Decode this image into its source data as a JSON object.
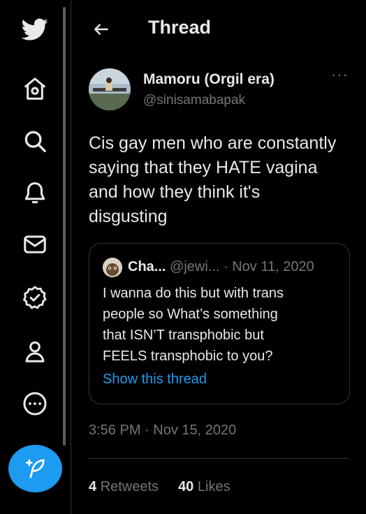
{
  "header": {
    "title": "Thread"
  },
  "sidebar": {
    "items": [
      {
        "icon": "twitter-bird-icon"
      },
      {
        "icon": "home-icon"
      },
      {
        "icon": "search-icon"
      },
      {
        "icon": "notifications-bell-icon"
      },
      {
        "icon": "messages-mail-icon"
      },
      {
        "icon": "verified-icon"
      },
      {
        "icon": "profile-icon"
      },
      {
        "icon": "more-icon"
      }
    ],
    "compose_icon": "compose-feather-icon"
  },
  "tweet": {
    "author_name": "Mamoru (Orgil era)",
    "author_handle": "@sinisamabapak",
    "text_lines": [
      "Cis gay men who are constantly",
      "saying that they HATE vagina",
      "and how they think it's",
      "disgusting"
    ],
    "timestamp": "3:56 PM · Nov 15, 2020",
    "retweets_count": "4",
    "retweets_label": "Retweets",
    "likes_count": "40",
    "likes_label": "Likes"
  },
  "quote": {
    "name": "Cha...",
    "handle_date": "@jewi... · Nov 11, 2020",
    "text_lines": [
      "I wanna do this but with trans",
      "people so What’s something",
      "that ISN’T transphobic but",
      "FEELS transphobic to you?"
    ],
    "show_thread": "Show this thread"
  },
  "colors": {
    "background": "#000000",
    "accent": "#1d9bf0",
    "text_primary": "#e7e9ea",
    "text_secondary": "#71767b",
    "border": "#2f3336"
  }
}
